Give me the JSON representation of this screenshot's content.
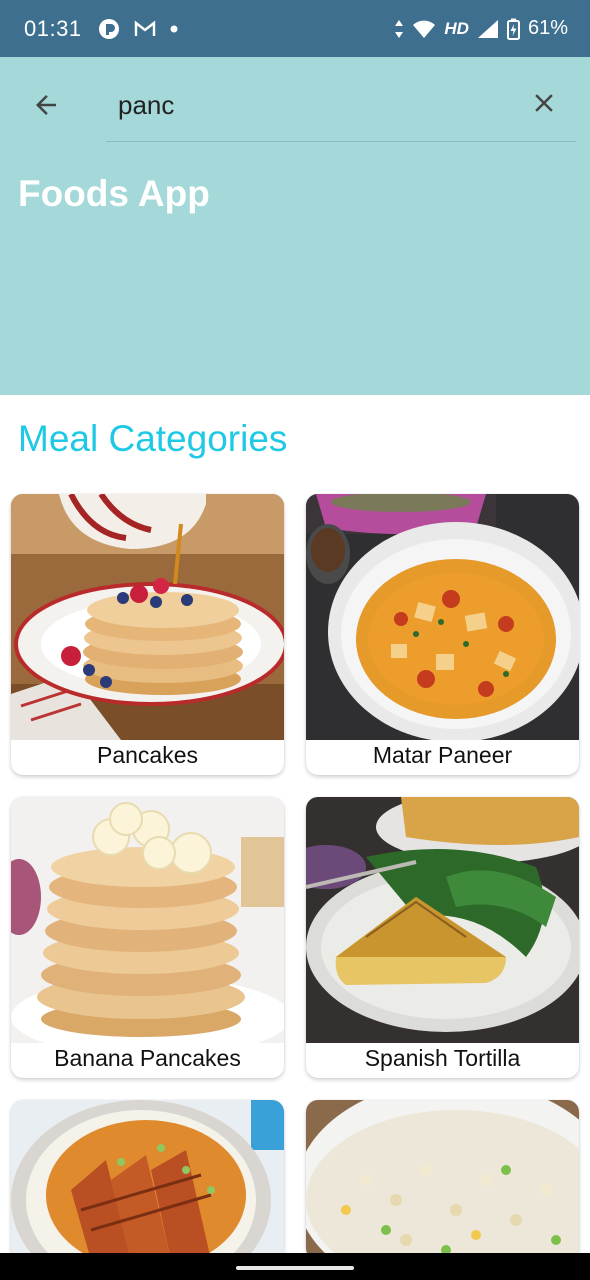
{
  "status_bar": {
    "time": "01:31",
    "network": "HD",
    "battery": "61%",
    "left_icons": [
      "app-icon",
      "gmail-icon",
      "dot-icon"
    ],
    "right_icons": [
      "data-arrows-icon",
      "wifi-icon",
      "signal-icon",
      "battery-charging-icon"
    ]
  },
  "header": {
    "search_value": "panc",
    "title": "Foods App",
    "back_icon": "arrow-left-icon",
    "clear_icon": "close-icon",
    "background_color": "#a4d8d9"
  },
  "section": {
    "title": "Meal Categories",
    "color": "#1fc9e6"
  },
  "meals": [
    {
      "name": "Pancakes",
      "image": "pancakes-photo"
    },
    {
      "name": "Matar Paneer",
      "image": "matar-paneer-photo"
    },
    {
      "name": "Banana Pancakes",
      "image": "banana-pancakes-photo"
    },
    {
      "name": "Spanish Tortilla",
      "image": "spanish-tortilla-photo"
    },
    {
      "name": "",
      "image": "chicken-rice-photo"
    },
    {
      "name": "",
      "image": "fried-rice-photo"
    }
  ],
  "colors": {
    "status_bar": "#3e6f8f",
    "accent": "#1fc9e6"
  }
}
